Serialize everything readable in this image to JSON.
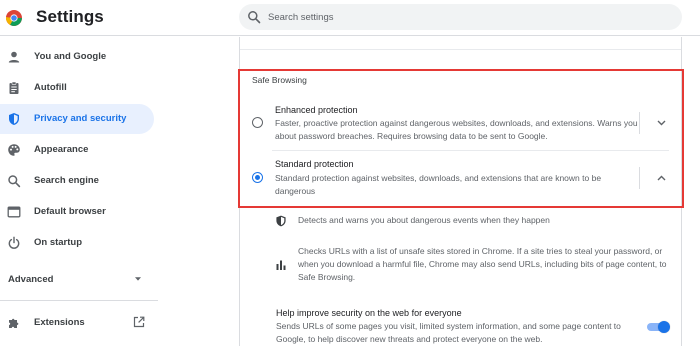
{
  "header": {
    "title": "Settings",
    "search_placeholder": "Search settings",
    "logo_icon": "chrome-logo-icon"
  },
  "sidebar": {
    "items": [
      {
        "label": "You and Google",
        "icon": "person-icon",
        "active": false
      },
      {
        "label": "Autofill",
        "icon": "clipboard-icon",
        "active": false
      },
      {
        "label": "Privacy and security",
        "icon": "shield-icon",
        "active": true
      },
      {
        "label": "Appearance",
        "icon": "palette-icon",
        "active": false
      },
      {
        "label": "Search engine",
        "icon": "search-icon",
        "active": false
      },
      {
        "label": "Default browser",
        "icon": "browser-window-icon",
        "active": false
      },
      {
        "label": "On startup",
        "icon": "power-icon",
        "active": false
      }
    ],
    "advanced_label": "Advanced",
    "extensions_label": "Extensions",
    "active_color": "#1a73e8",
    "active_bg": "#e8f0fe"
  },
  "safe_browsing": {
    "section_title": "Safe Browsing",
    "options": [
      {
        "title": "Enhanced protection",
        "description": "Faster, proactive protection against dangerous websites, downloads, and extensions. Warns you about password breaches. Requires browsing data to be sent to Google.",
        "selected": false,
        "expanded": false
      },
      {
        "title": "Standard protection",
        "description": "Standard protection against websites, downloads, and extensions that are known to be dangerous",
        "selected": true,
        "expanded": true
      }
    ],
    "details": [
      {
        "icon": "shield-icon",
        "text": "Detects and warns you about dangerous events when they happen"
      },
      {
        "icon": "bar-chart-icon",
        "text": "Checks URLs with a list of unsafe sites stored in Chrome. If a site tries to steal your password, or when you download a harmful file, Chrome may also send URLs, including bits of page content, to Safe Browsing."
      }
    ],
    "help_improve": {
      "title": "Help improve security on the web for everyone",
      "description": "Sends URLs of some pages you visit, limited system information, and some page content to Google, to help discover new threats and protect everyone on the web.",
      "enabled": true
    },
    "highlight_color": "#e53935"
  }
}
